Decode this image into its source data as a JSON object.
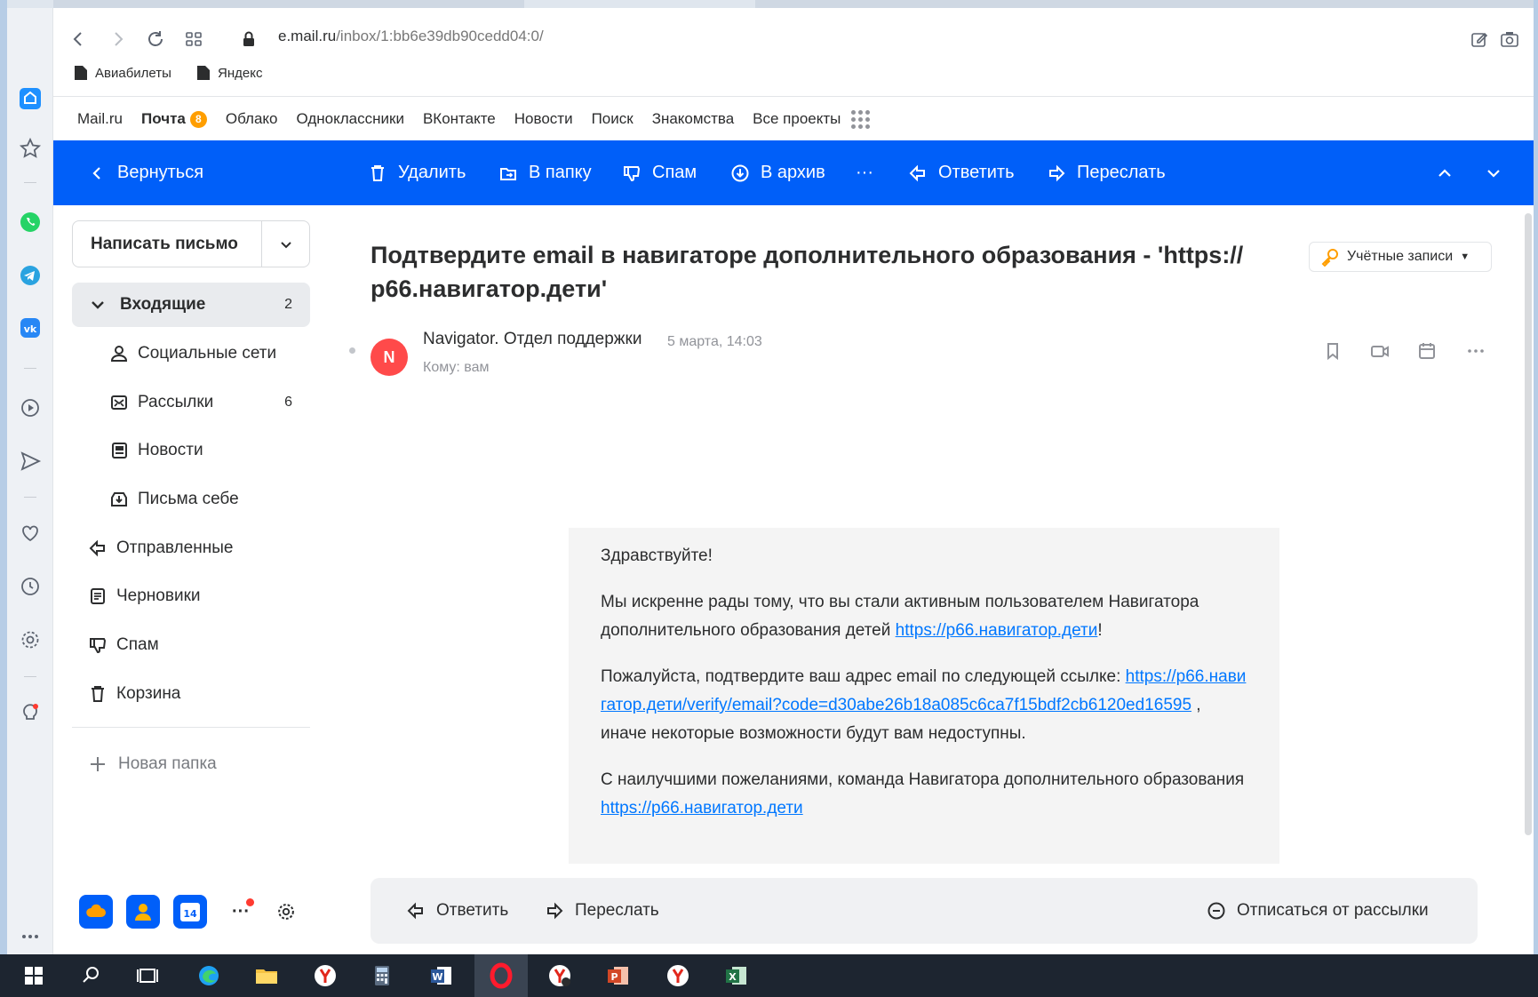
{
  "browser": {
    "url_host": "e.mail.ru",
    "url_path": "/inbox/1:bb6e39db90cedd04:0/",
    "bookmarks": [
      "Авиабилеты",
      "Яндекс"
    ]
  },
  "portal_nav": {
    "items": [
      "Mail.ru",
      "Почта",
      "Облако",
      "Одноклассники",
      "ВКонтакте",
      "Новости",
      "Поиск",
      "Знакомства",
      "Все проекты"
    ],
    "mail_badge": "8"
  },
  "toolbar": {
    "back": "Вернуться",
    "delete": "Удалить",
    "to_folder": "В папку",
    "spam": "Спам",
    "archive": "В архив",
    "more": "···",
    "reply": "Ответить",
    "forward": "Переслать"
  },
  "sidebar": {
    "compose": "Написать письмо",
    "folders": [
      {
        "label": "Входящие",
        "count": "2"
      },
      {
        "label": "Социальные сети",
        "count": ""
      },
      {
        "label": "Рассылки",
        "count": "6"
      },
      {
        "label": "Новости",
        "count": ""
      },
      {
        "label": "Письма себе",
        "count": ""
      },
      {
        "label": "Отправленные",
        "count": ""
      },
      {
        "label": "Черновики",
        "count": ""
      },
      {
        "label": "Спам",
        "count": ""
      },
      {
        "label": "Корзина",
        "count": ""
      }
    ],
    "new_folder": "Новая папка",
    "calendar_day": "14",
    "more": "···"
  },
  "letter": {
    "subject": "Подтвердите email в навигаторе дополнительного образования - 'https://р66.навигатор.дети'",
    "accounts_button": "Учётные записи",
    "avatar_letter": "N",
    "sender": "Navigator. Отдел поддержки",
    "date": "5 марта, 14:03",
    "recipient": "Кому: вам",
    "body": {
      "greeting": "Здравствуйте!",
      "p1_text": "Мы искренне рады тому, что вы стали активным пользователем Навигатора дополнительного образования детей ",
      "p1_link": "https://р66.навигатор.дети",
      "p1_end": "!",
      "p2_text": "Пожалуйста, подтвердите ваш адрес email по следующей ссылке: ",
      "p2_link": "https://р66.навигатор.дети/verify/email?code=d30abe26b18a085c6ca7f15bdf2cb6120ed16595",
      "p2_end": " , иначе некоторые возможности будут вам недоступны.",
      "p3_text": "С наилучшими пожеланиями, команда Навигатора дополнительного образования ",
      "p3_link": "https://р66.навигатор.дети"
    }
  },
  "reply_bar": {
    "reply": "Ответить",
    "forward": "Переслать",
    "unsubscribe": "Отписаться от рассылки"
  },
  "colors": {
    "accent": "#005ff9",
    "link": "#0077ff",
    "badge": "#ff9e00",
    "avatar": "#ff4a4a"
  }
}
